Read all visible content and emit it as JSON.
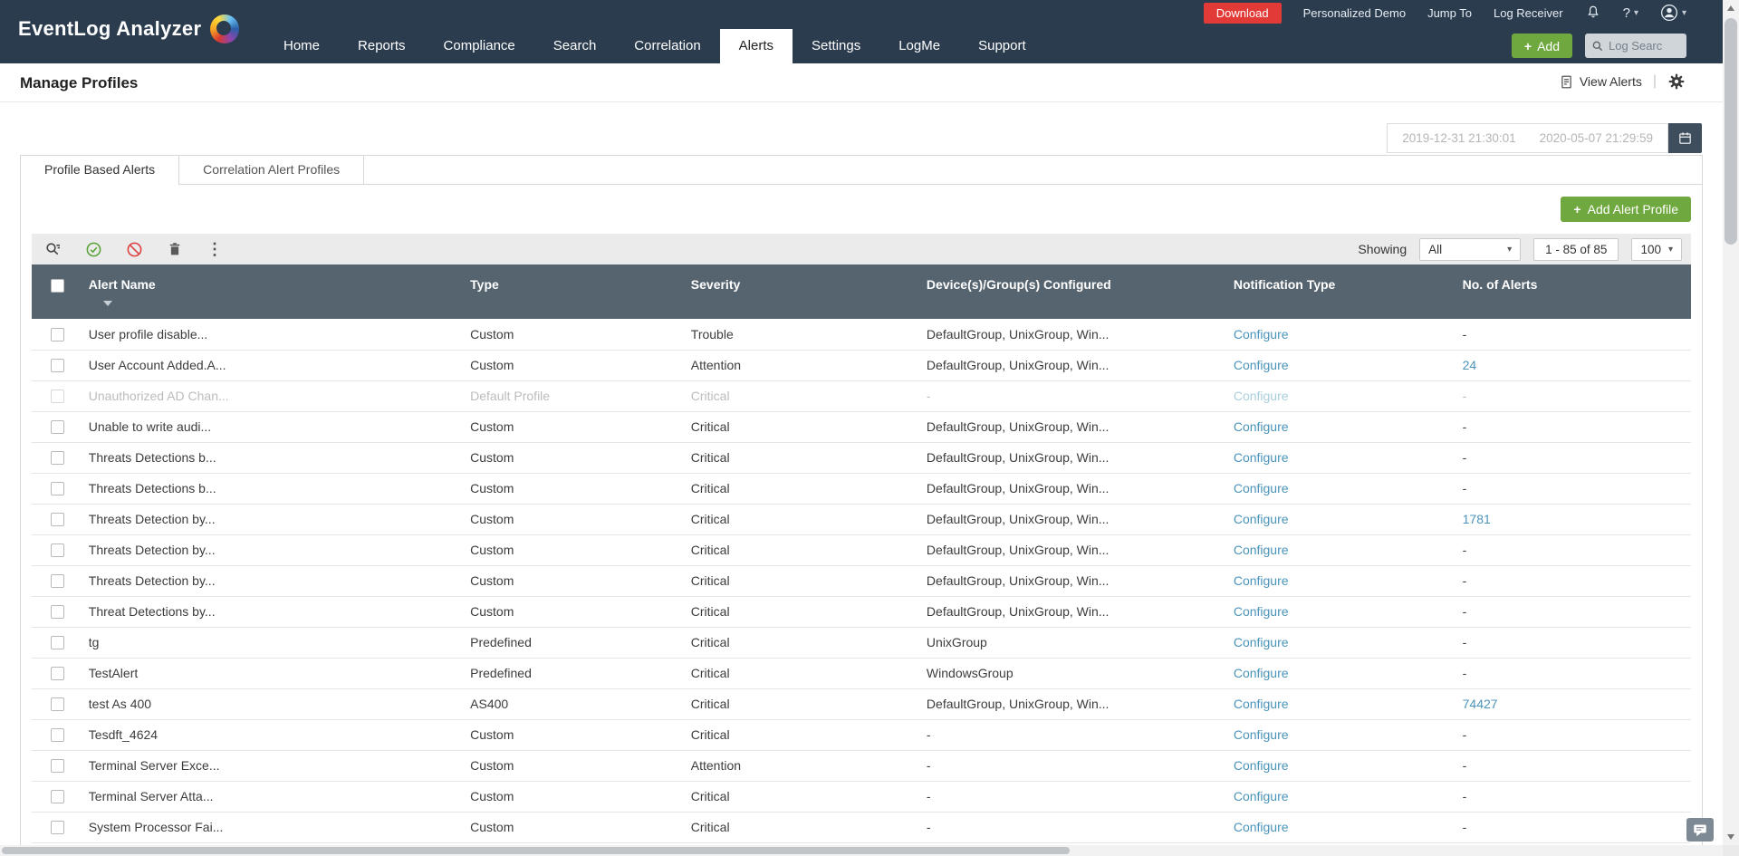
{
  "icons": {
    "plus": "+",
    "caret_down": "▾",
    "kebab": "⋮",
    "separator": "|"
  },
  "colors": {
    "topbar": "#2b3c4f",
    "accent_green": "#6fa83f",
    "accent_red": "#e23a36",
    "link_blue": "#4a94ba",
    "table_header": "#56646f"
  },
  "topbar": {
    "brand": "EventLog Analyzer",
    "utility": {
      "download": "Download",
      "personalized_demo": "Personalized Demo",
      "jump_to": "Jump To",
      "log_receiver": "Log Receiver",
      "help": "?"
    },
    "nav": [
      {
        "label": "Home",
        "active": false
      },
      {
        "label": "Reports",
        "active": false
      },
      {
        "label": "Compliance",
        "active": false
      },
      {
        "label": "Search",
        "active": false
      },
      {
        "label": "Correlation",
        "active": false
      },
      {
        "label": "Alerts",
        "active": true
      },
      {
        "label": "Settings",
        "active": false
      },
      {
        "label": "LogMe",
        "active": false
      },
      {
        "label": "Support",
        "active": false
      }
    ],
    "add_label": "Add",
    "search_placeholder": "Log Searc"
  },
  "page": {
    "title": "Manage Profiles",
    "view_alerts": "View Alerts"
  },
  "daterange": {
    "from": "2019-12-31 21:30:01",
    "to": "2020-05-07 21:29:59"
  },
  "tabs": [
    {
      "label": "Profile Based Alerts",
      "active": true
    },
    {
      "label": "Correlation Alert Profiles",
      "active": false
    }
  ],
  "panel": {
    "add_button_label": "Add Alert Profile"
  },
  "toolbar": {
    "showing_label": "Showing",
    "filter_value": "All",
    "range_text": "1 - 85 of 85",
    "page_size": "100"
  },
  "table": {
    "columns": [
      "Alert Name",
      "Type",
      "Severity",
      "Device(s)/Group(s) Configured",
      "Notification Type",
      "No. of Alerts"
    ],
    "rows": [
      {
        "name": "User profile disable...",
        "type": "Custom",
        "severity": "Trouble",
        "devices": "DefaultGroup, UnixGroup, Win...",
        "notification": "Configure",
        "count": "-",
        "disabled": false
      },
      {
        "name": "User Account Added.A...",
        "type": "Custom",
        "severity": "Attention",
        "devices": "DefaultGroup, UnixGroup, Win...",
        "notification": "Configure",
        "count": "24",
        "disabled": false
      },
      {
        "name": "Unauthorized AD Chan...",
        "type": "Default Profile",
        "severity": "Critical",
        "devices": "-",
        "notification": "Configure",
        "count": "-",
        "disabled": true
      },
      {
        "name": "Unable to write audi...",
        "type": "Custom",
        "severity": "Critical",
        "devices": "DefaultGroup, UnixGroup, Win...",
        "notification": "Configure",
        "count": "-",
        "disabled": false
      },
      {
        "name": "Threats Detections b...",
        "type": "Custom",
        "severity": "Critical",
        "devices": "DefaultGroup, UnixGroup, Win...",
        "notification": "Configure",
        "count": "-",
        "disabled": false
      },
      {
        "name": "Threats Detections b...",
        "type": "Custom",
        "severity": "Critical",
        "devices": "DefaultGroup, UnixGroup, Win...",
        "notification": "Configure",
        "count": "-",
        "disabled": false
      },
      {
        "name": "Threats Detection by...",
        "type": "Custom",
        "severity": "Critical",
        "devices": "DefaultGroup, UnixGroup, Win...",
        "notification": "Configure",
        "count": "1781",
        "disabled": false
      },
      {
        "name": "Threats Detection by...",
        "type": "Custom",
        "severity": "Critical",
        "devices": "DefaultGroup, UnixGroup, Win...",
        "notification": "Configure",
        "count": "-",
        "disabled": false
      },
      {
        "name": "Threats Detection by...",
        "type": "Custom",
        "severity": "Critical",
        "devices": "DefaultGroup, UnixGroup, Win...",
        "notification": "Configure",
        "count": "-",
        "disabled": false
      },
      {
        "name": "Threat Detections by...",
        "type": "Custom",
        "severity": "Critical",
        "devices": "DefaultGroup, UnixGroup, Win...",
        "notification": "Configure",
        "count": "-",
        "disabled": false
      },
      {
        "name": "tg",
        "type": "Predefined",
        "severity": "Critical",
        "devices": "UnixGroup",
        "notification": "Configure",
        "count": "-",
        "disabled": false
      },
      {
        "name": "TestAlert",
        "type": "Predefined",
        "severity": "Critical",
        "devices": "WindowsGroup",
        "notification": "Configure",
        "count": "-",
        "disabled": false
      },
      {
        "name": "test As 400",
        "type": "AS400",
        "severity": "Critical",
        "devices": "DefaultGroup, UnixGroup, Win...",
        "notification": "Configure",
        "count": "74427",
        "disabled": false
      },
      {
        "name": "Tesdft_4624",
        "type": "Custom",
        "severity": "Critical",
        "devices": "-",
        "notification": "Configure",
        "count": "-",
        "disabled": false
      },
      {
        "name": "Terminal Server Exce...",
        "type": "Custom",
        "severity": "Attention",
        "devices": "-",
        "notification": "Configure",
        "count": "-",
        "disabled": false
      },
      {
        "name": "Terminal Server Atta...",
        "type": "Custom",
        "severity": "Critical",
        "devices": "-",
        "notification": "Configure",
        "count": "-",
        "disabled": false
      },
      {
        "name": "System Processor Fai...",
        "type": "Custom",
        "severity": "Critical",
        "devices": "-",
        "notification": "Configure",
        "count": "-",
        "disabled": false
      }
    ]
  }
}
